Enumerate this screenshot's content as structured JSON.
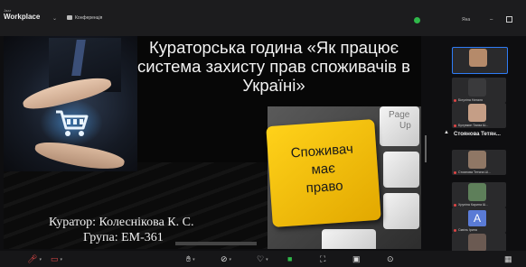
{
  "app": {
    "brand_small": "Jazz",
    "brand_big": "Workplace",
    "chevron": "⌄",
    "conference_label": "Конференція",
    "user_name": "Яна",
    "minimize": "–"
  },
  "slide": {
    "title": "Кураторська година «Як працює система захисту прав споживачів в Україні»",
    "keys": {
      "page": "Page",
      "up": "Up",
      "yellow_line1": "Споживач",
      "yellow_line2": "має",
      "yellow_line3": "право"
    },
    "curator": "Куратор: Колеснікова К. С.",
    "group": "Група: ЕМ-361"
  },
  "participants": {
    "featured_name": "Стоянова Тетян...",
    "tiles": [
      {
        "name": "",
        "photo_color": "#b58a6a",
        "active": true
      },
      {
        "name": "Білуліна Наталя",
        "photo_color": "#3a3a3c",
        "active": false
      },
      {
        "name": "Булувкин Таєва Ш...",
        "photo_color": "#c59e86",
        "active": false
      },
      {
        "name": "Стоянова Тетяна Ш...",
        "photo_color": "#8f7765",
        "active": false
      },
      {
        "name": "Хрупіна Карина Ш...",
        "photo_color": "#5e7f5a",
        "active": false
      },
      {
        "name": "Сквіль Ірина",
        "photo_color": "#5a7bd6",
        "letter": "A",
        "active": false
      },
      {
        "name": "Нікта Федотов Ш...",
        "photo_color": "#6b5a52",
        "active": false
      }
    ]
  },
  "toolbar": {
    "mic_icon": "microphone-off",
    "camera_icon": "camera-off",
    "reactions_icon": "hand",
    "share_icon": "share",
    "chat_icon": "chat",
    "record_icon": "record",
    "colors": {
      "danger": "#e24a4a",
      "active": "#2fb84a",
      "accent": "#2f7cf6"
    }
  }
}
